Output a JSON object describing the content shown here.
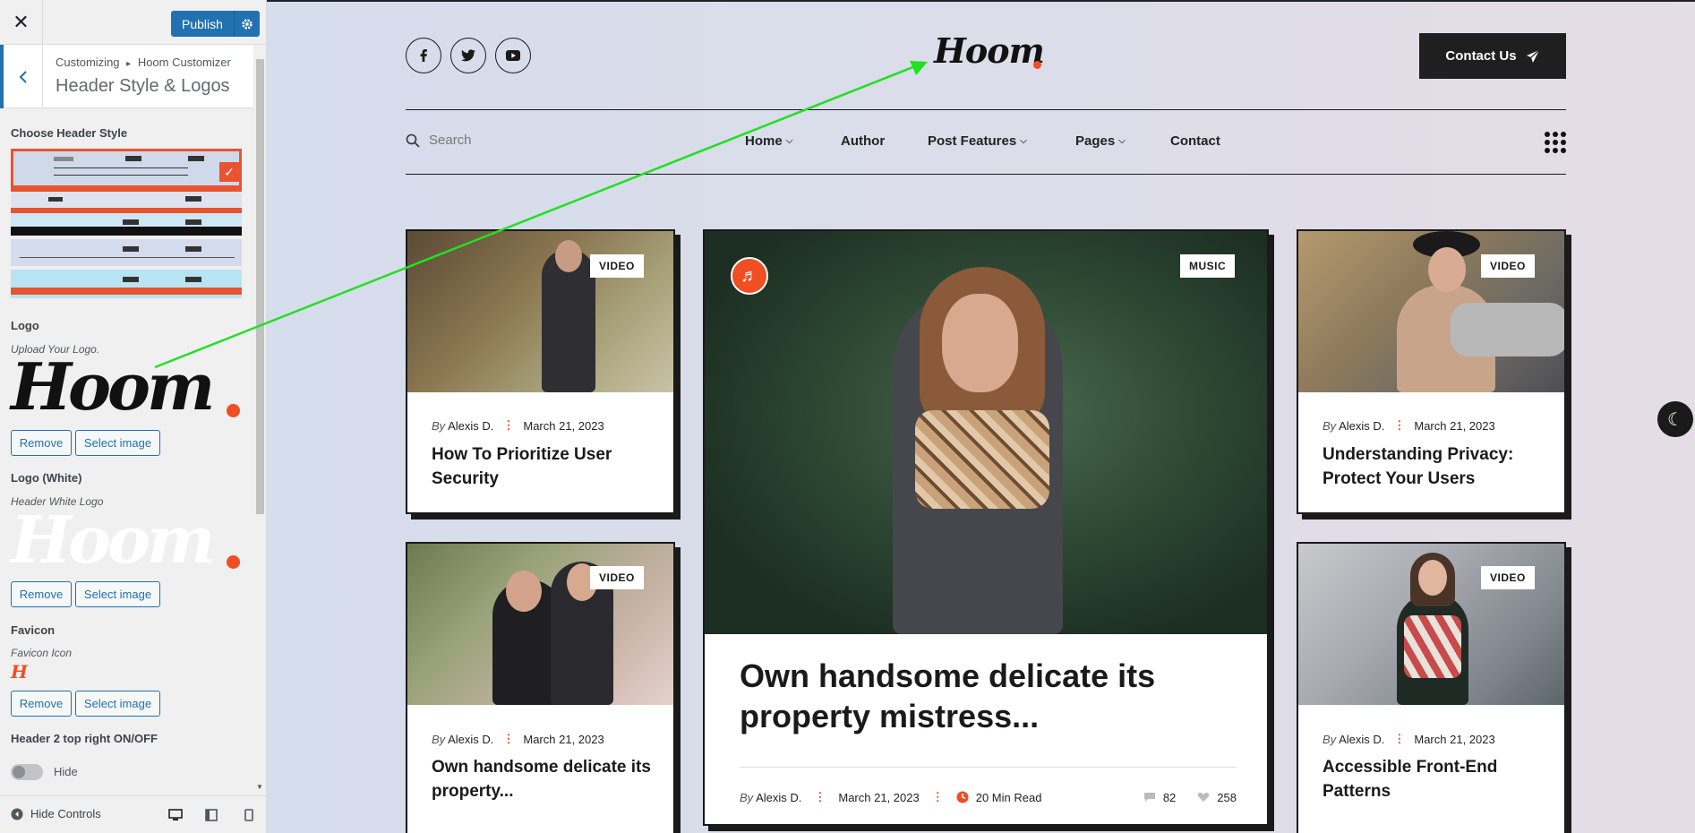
{
  "customizer": {
    "close": "✕",
    "publish_label": "Publish",
    "crumb_root": "Customizing",
    "crumb_sep": "▸",
    "crumb_parent": "Hoom Customizer",
    "section_title": "Header Style & Logos",
    "header_style_label": "Choose Header Style",
    "logo_label": "Logo",
    "logo_desc": "Upload Your Logo.",
    "logo_text": "Hoom",
    "logo_white_label": "Logo (White)",
    "logo_white_desc": "Header White Logo",
    "favicon_label": "Favicon",
    "favicon_desc": "Favicon Icon",
    "favicon_text": "H",
    "remove_label": "Remove",
    "select_image_label": "Select image",
    "header2_label": "Header 2 top right ON/OFF",
    "toggle_label": "Hide",
    "hide_controls_label": "Hide Controls"
  },
  "site": {
    "logo_text": "Hoom",
    "contact_label": "Contact Us",
    "search_placeholder": "Search",
    "nav": [
      "Home",
      "Author",
      "Post Features",
      "Pages",
      "Contact"
    ],
    "social": [
      "facebook-icon",
      "twitter-icon",
      "youtube-icon"
    ]
  },
  "posts": [
    {
      "tag": "VIDEO",
      "by": "By",
      "author": "Alexis D.",
      "date": "March 21, 2023",
      "title": "How To Prioritize User Security"
    },
    {
      "tag": "MUSIC",
      "by": "By",
      "author": "Alexis D.",
      "date": "March 21, 2023",
      "title": "Own handsome delicate its property mistress...",
      "read_time": "20 Min Read",
      "comments": "82",
      "likes": "258"
    },
    {
      "tag": "VIDEO",
      "by": "By",
      "author": "Alexis D.",
      "date": "March 21, 2023",
      "title": "Understanding Privacy: Protect Your Users"
    },
    {
      "tag": "VIDEO",
      "by": "By",
      "author": "Alexis D.",
      "date": "March 21, 2023",
      "title": "Own handsome delicate its property..."
    },
    {
      "tag": "VIDEO",
      "by": "By",
      "author": "Alexis D.",
      "date": "March 21, 2023",
      "title": "Accessible Front-End Patterns"
    }
  ],
  "colors": {
    "accent": "#f04e23",
    "wp_blue": "#2271b1",
    "dark": "#1a1a1a",
    "arrow": "#22e022"
  }
}
